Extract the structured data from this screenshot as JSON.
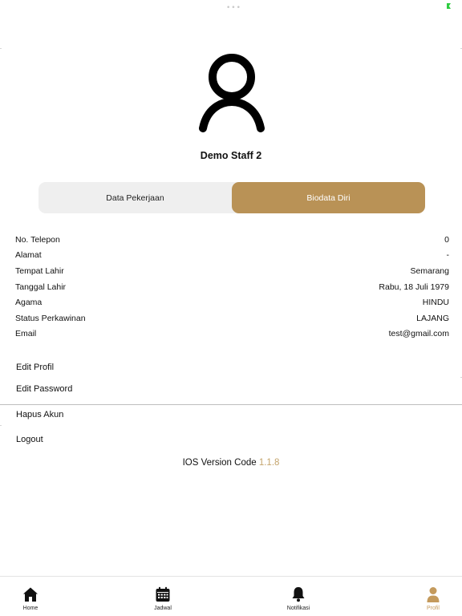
{
  "profile": {
    "name": "Demo Staff 2"
  },
  "tabs": [
    {
      "label": "Data Pekerjaan",
      "active": false
    },
    {
      "label": "Biodata Diri",
      "active": true
    }
  ],
  "info_rows": [
    {
      "label": "No. Telepon",
      "value": "0"
    },
    {
      "label": "Alamat",
      "value": "-"
    },
    {
      "label": "Tempat Lahir",
      "value": "Semarang"
    },
    {
      "label": "Tanggal Lahir",
      "value": "Rabu, 18 Juli 1979"
    },
    {
      "label": "Agama",
      "value": "HINDU"
    },
    {
      "label": "Status Perkawinan",
      "value": "LAJANG"
    },
    {
      "label": "Email",
      "value": "test@gmail.com"
    }
  ],
  "menu": {
    "edit_profile": "Edit Profil",
    "edit_password": "Edit Password",
    "delete_account": "Hapus Akun",
    "logout": "Logout"
  },
  "version": {
    "label": "IOS Version Code",
    "number": "1.1.8"
  },
  "tabbar": [
    {
      "label": "Home",
      "icon": "home-icon",
      "active": false
    },
    {
      "label": "Jadwal",
      "icon": "calendar-icon",
      "active": false
    },
    {
      "label": "Notifikasi",
      "icon": "bell-icon",
      "active": false
    },
    {
      "label": "Profil",
      "icon": "person-icon",
      "active": true
    }
  ],
  "colors": {
    "accent": "#b99256",
    "version_number": "#c4a46c",
    "active_tab": "#c49a5c"
  }
}
